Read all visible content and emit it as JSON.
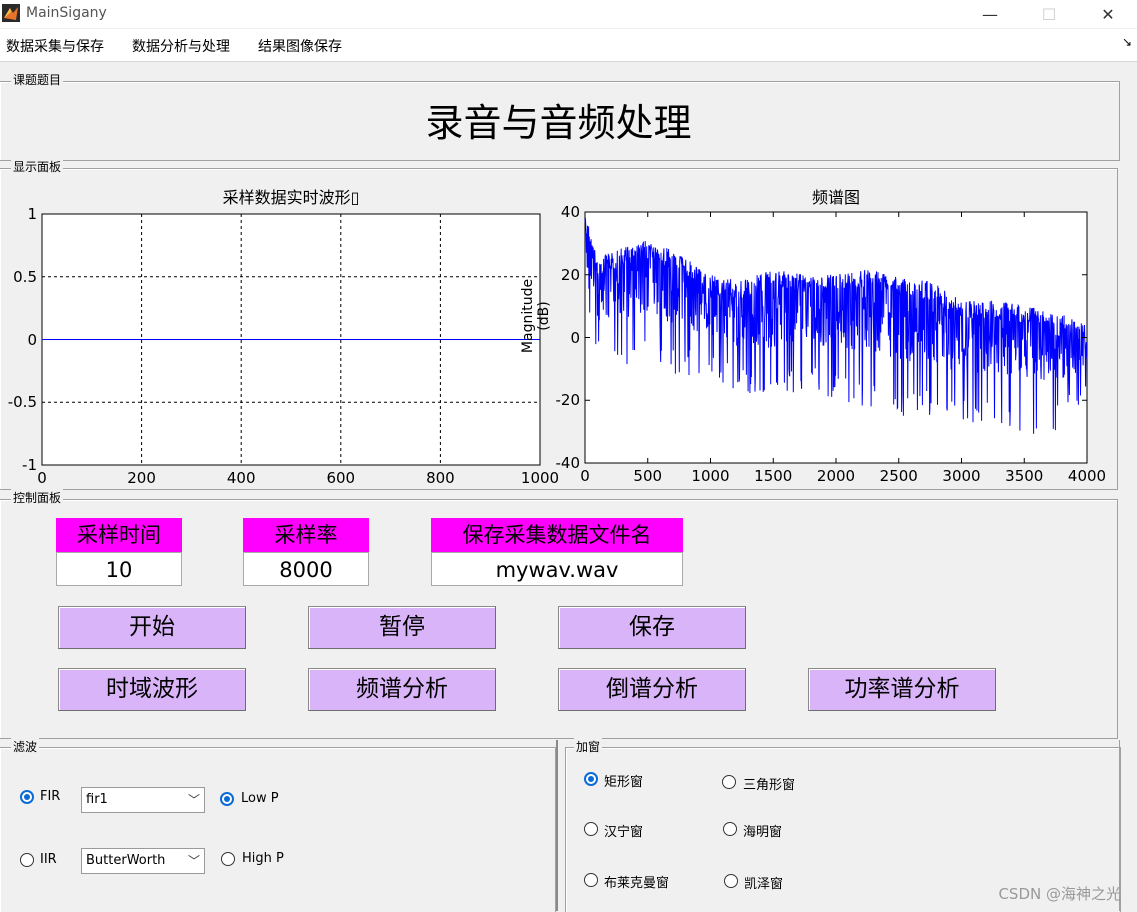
{
  "window": {
    "title": "MainSigany",
    "minimize": "—",
    "maximize": "☐",
    "close": "✕"
  },
  "menu": [
    "数据采集与保存",
    "数据分析与处理",
    "结果图像保存"
  ],
  "topic": {
    "label": "课题题目",
    "text": "录音与音频处理"
  },
  "display": {
    "label": "显示面板",
    "wave": {
      "title": "采样数据实时波形▯",
      "yticks": [
        "1",
        "0.5",
        "0",
        "-0.5",
        "-1"
      ],
      "xticks": [
        "0",
        "200",
        "400",
        "600",
        "800",
        "1000"
      ]
    },
    "spectrum": {
      "title": "频谱图",
      "ylabel": "Magnitude (dB)",
      "yticks": [
        "40",
        "20",
        "0",
        "-20",
        "-40"
      ],
      "xticks": [
        "0",
        "500",
        "1000",
        "1500",
        "2000",
        "2500",
        "3000",
        "3500",
        "4000"
      ]
    }
  },
  "chart_data": [
    {
      "type": "line",
      "title": "采样数据实时波形▯",
      "x": [
        0,
        1000
      ],
      "y": [
        0,
        0
      ],
      "xlim": [
        0,
        1000
      ],
      "ylim": [
        -1,
        1
      ],
      "grid": true,
      "color": "#0000ff"
    },
    {
      "type": "line",
      "title": "频谱图",
      "ylabel": "Magnitude (dB)",
      "xlim": [
        0,
        4000
      ],
      "ylim": [
        -40,
        40
      ],
      "grid": false,
      "color": "#0000ff",
      "envelope": {
        "x": [
          0,
          100,
          250,
          500,
          750,
          1000,
          1250,
          1500,
          1750,
          2000,
          2250,
          2500,
          2750,
          3000,
          3250,
          3500,
          3750,
          4000
        ],
        "upper": [
          40,
          25,
          28,
          31,
          27,
          20,
          18,
          22,
          20,
          20,
          22,
          19,
          18,
          12,
          12,
          10,
          9,
          4
        ],
        "lower": [
          15,
          -8,
          -10,
          -8,
          -12,
          -12,
          -18,
          -20,
          -16,
          -20,
          -22,
          -25,
          -25,
          -28,
          -28,
          -32,
          -30,
          -20
        ]
      }
    }
  ],
  "control": {
    "label": "控制面板",
    "fields": [
      {
        "label": "采样时间",
        "value": "10"
      },
      {
        "label": "采样率",
        "value": "8000"
      },
      {
        "label": "保存采集数据文件名",
        "value": "mywav.wav"
      }
    ],
    "buttons_row1": [
      "开始",
      "暂停",
      "保存"
    ],
    "buttons_row2": [
      "时域波形",
      "频谱分析",
      "倒谱分析",
      "功率谱分析"
    ]
  },
  "filter": {
    "label": "滤波",
    "fir": {
      "label": "FIR",
      "selected": true,
      "combo": "fir1"
    },
    "iir": {
      "label": "IIR",
      "selected": false,
      "combo": "ButterWorth"
    },
    "lowp": {
      "label": "Low P",
      "selected": true
    },
    "highp": {
      "label": "High P",
      "selected": false
    }
  },
  "window_fn": {
    "label": "加窗",
    "options": [
      {
        "label": "矩形窗",
        "selected": true
      },
      {
        "label": "三角形窗",
        "selected": false
      },
      {
        "label": "汉宁窗",
        "selected": false
      },
      {
        "label": "海明窗",
        "selected": false
      },
      {
        "label": "布莱克曼窗",
        "selected": false
      },
      {
        "label": "凯泽窗",
        "selected": false
      }
    ]
  },
  "watermark": "CSDN @海神之光"
}
